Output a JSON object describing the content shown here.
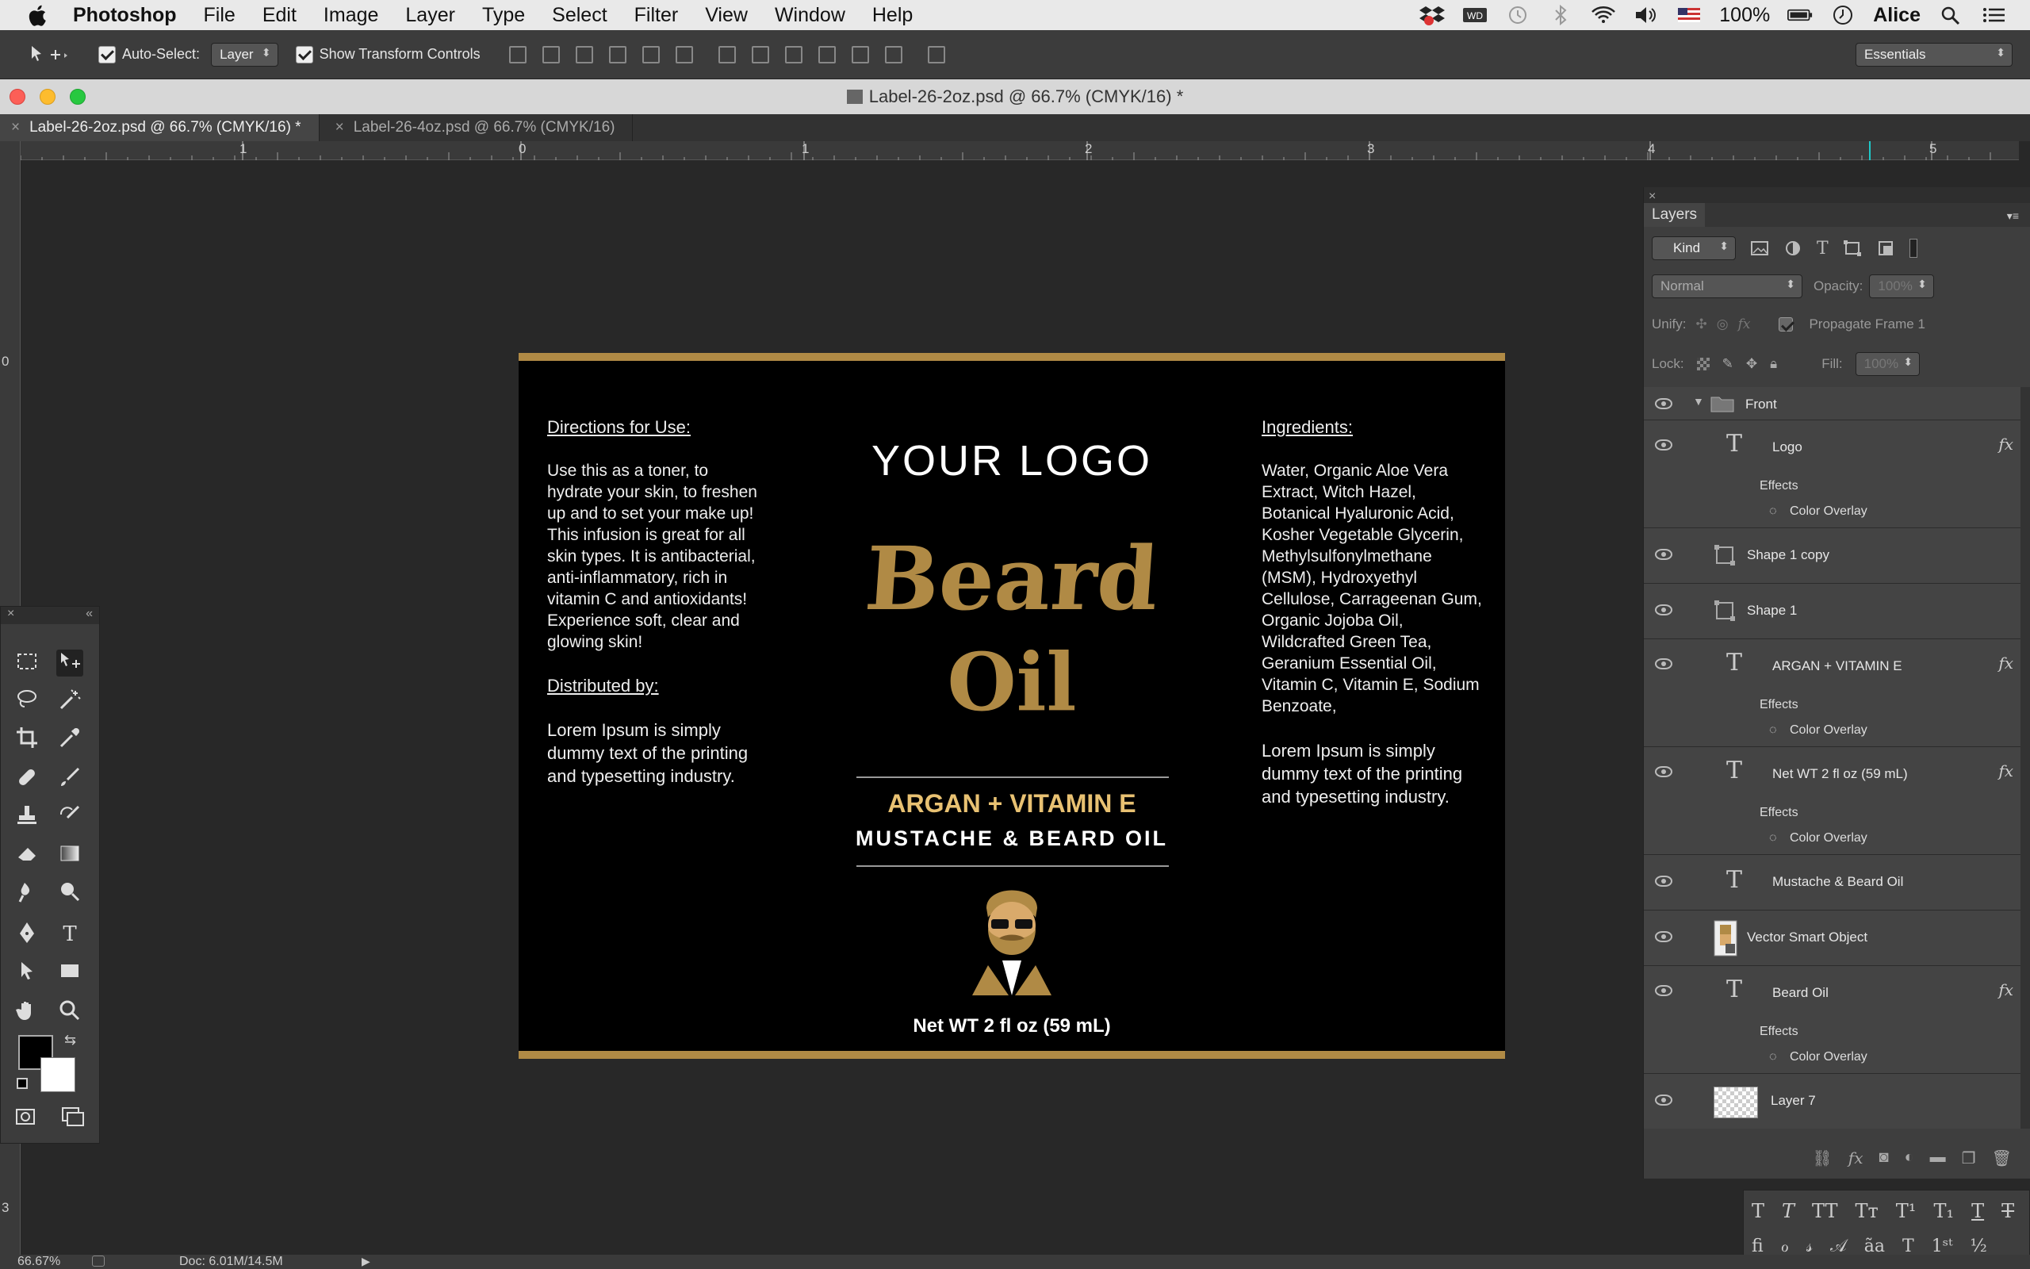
{
  "menubar": {
    "app": "Photoshop",
    "items": [
      "File",
      "Edit",
      "Image",
      "Layer",
      "Type",
      "Select",
      "Filter",
      "View",
      "Window",
      "Help"
    ],
    "battery": "100%",
    "user": "Alice"
  },
  "options": {
    "auto_select_label": "Auto-Select:",
    "auto_select_value": "Layer",
    "transform_label": "Show Transform Controls",
    "workspace": "Essentials"
  },
  "window": {
    "title": "Label-26-2oz.psd @ 66.7% (CMYK/16) *"
  },
  "tabs": [
    {
      "label": "Label-26-2oz.psd @ 66.7% (CMYK/16) *"
    },
    {
      "label": "Label-26-4oz.psd @ 66.7% (CMYK/16)"
    }
  ],
  "ruler": {
    "h_labels": [
      "1",
      "0",
      "1",
      "2",
      "3",
      "4",
      "5"
    ],
    "v_labels": [
      "0",
      "3"
    ]
  },
  "label": {
    "directions_heading": "Directions for Use:",
    "directions_text": "Use this as a toner, to hydrate your skin, to freshen up and to set your make up! This infusion is great for all skin types. It is antibacterial, anti-inflammatory, rich in vitamin C and antioxidants! Experience soft, clear and glowing skin!",
    "distributed_heading": "Distributed by:",
    "distributed_text": "Lorem Ipsum is simply dummy text of the printing and typesetting industry.",
    "logo": "YOUR LOGO",
    "beard": "Beard",
    "oil": "Oil",
    "argan": "ARGAN + VITAMIN E",
    "mustache": "MUSTACHE & BEARD OIL",
    "netwt": "Net WT 2 fl oz (59 mL)",
    "ingredients_heading": "Ingredients:",
    "ingredients_text": "Water, Organic Aloe Vera Extract, Witch Hazel, Botanical Hyaluronic Acid, Kosher Vegetable Glycerin, Methylsulfonylmethane (MSM), Hydroxyethyl Cellulose, Carrageenan Gum, Organic Jojoba Oil, Wildcrafted Green Tea, Geranium Essential Oil, Vitamin C, Vitamin E, Sodium Benzoate,",
    "ingredients_lorem": "Lorem Ipsum is simply dummy text of the printing and typesetting industry.",
    "gold_color": "#b08a45"
  },
  "layers_panel": {
    "tab": "Layers",
    "filter": "Kind",
    "blend": "Normal",
    "opacity_label": "Opacity:",
    "opacity_value": "100%",
    "unify_label": "Unify:",
    "propagate_label": "Propagate Frame 1",
    "lock_label": "Lock:",
    "fill_label": "Fill:",
    "fill_value": "100%",
    "group": "Front",
    "effects_label": "Effects",
    "color_overlay_label": "Color Overlay",
    "layers": [
      {
        "name": "Logo"
      },
      {
        "name": "Shape 1 copy"
      },
      {
        "name": "Shape 1"
      },
      {
        "name": "ARGAN + VITAMIN E"
      },
      {
        "name": "Net WT 2 fl oz (59 mL)"
      },
      {
        "name": "Mustache & Beard Oil"
      },
      {
        "name": "Vector Smart Object"
      },
      {
        "name": "Beard Oil"
      },
      {
        "name": "Layer 7"
      }
    ]
  },
  "status": {
    "zoom": "66.67%",
    "doc": "Doc: 6.01M/14.5M"
  }
}
